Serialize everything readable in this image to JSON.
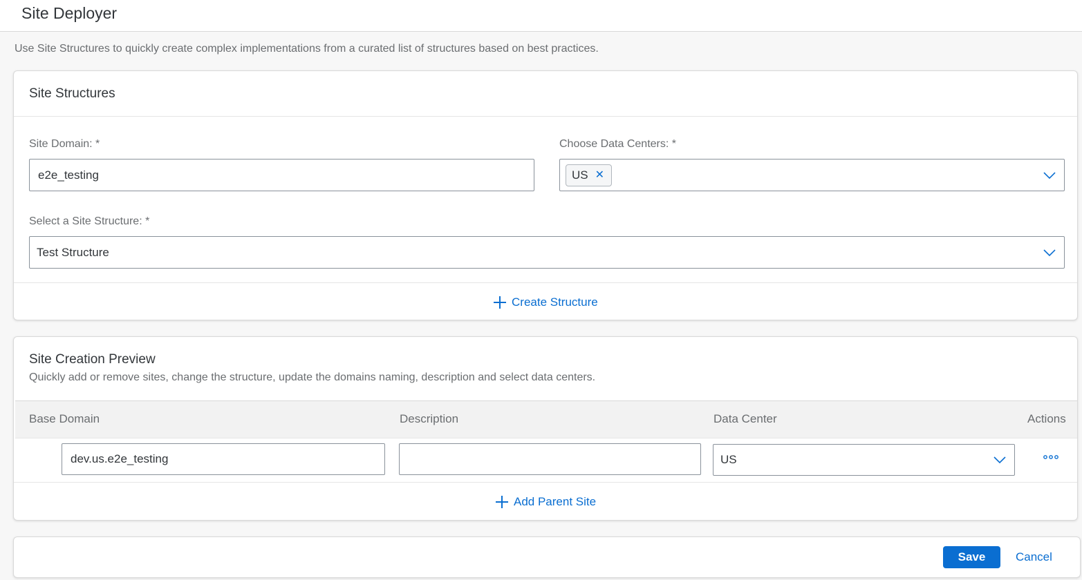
{
  "app": {
    "title": "Site Deployer"
  },
  "intro": "Use Site Structures to quickly create complex implementations from a curated list of structures based on best practices.",
  "structures": {
    "title": "Site Structures",
    "site_domain_label": "Site Domain: *",
    "site_domain_value": "e2e_testing",
    "data_centers_label": "Choose Data Centers: *",
    "data_centers_tokens": [
      "US"
    ],
    "structure_label": "Select a Site Structure: *",
    "structure_value": "Test Structure",
    "create_structure_label": "Create Structure"
  },
  "preview": {
    "title": "Site Creation Preview",
    "subtitle": "Quickly add or remove sites, change the structure, update the domains naming, description and select data centers.",
    "columns": [
      "Base Domain",
      "Description",
      "Data Center",
      "Actions"
    ],
    "rows": [
      {
        "base_domain": "dev.us.e2e_testing",
        "description": "",
        "data_center": "US"
      }
    ],
    "add_parent_label": "Add Parent Site"
  },
  "footer": {
    "save_label": "Save",
    "cancel_label": "Cancel"
  },
  "colors": {
    "accent": "#0a6ed1",
    "text": "#32363a",
    "muted": "#6a6d70",
    "border": "#89919a"
  },
  "icons": {
    "chevron": "chevron-down-icon",
    "plus": "plus-icon",
    "close": "close-icon",
    "more": "more-icon"
  }
}
